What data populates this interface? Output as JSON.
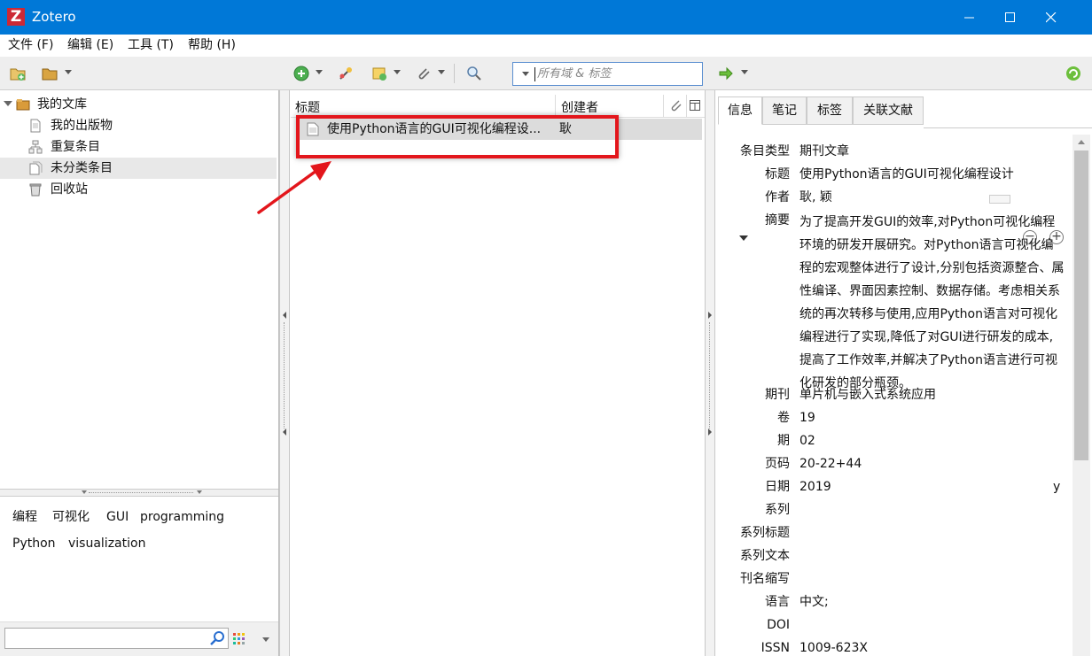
{
  "window": {
    "title": "Zotero",
    "logo_letter": "Z"
  },
  "menu": [
    {
      "label": "文件 (F)"
    },
    {
      "label": "编辑 (E)"
    },
    {
      "label": "工具 (T)"
    },
    {
      "label": "帮助 (H)"
    }
  ],
  "search": {
    "placeholder": "所有域 & 标签"
  },
  "library": {
    "root": "我的文库",
    "items": [
      {
        "label": "我的出版物"
      },
      {
        "label": "重复条目"
      },
      {
        "label": "未分类条目"
      },
      {
        "label": "回收站"
      }
    ]
  },
  "tags": [
    "编程",
    "可视化",
    "GUI",
    "programming",
    "Python",
    "visualization"
  ],
  "items_list": {
    "columns": {
      "title": "标题",
      "creator": "创建者"
    },
    "rows": [
      {
        "title": "使用Python语言的GUI可视化编程设...",
        "creator": "耿"
      }
    ]
  },
  "tabs": [
    "信息",
    "笔记",
    "标签",
    "关联文献"
  ],
  "info": {
    "item_type_label": "条目类型",
    "item_type": "期刊文章",
    "title_label": "标题",
    "title": "使用Python语言的GUI可视化编程设计",
    "author_label": "作者",
    "author": "耿, 颖",
    "abstract_label": "摘要",
    "abstract": "为了提高开发GUI的效率,对Python可视化编程环境的研发开展研究。对Python语言可视化编程的宏观整体进行了设计,分别包括资源整合、属性编译、界面因素控制、数据存储。考虑相关系统的再次转移与使用,应用Python语言对可视化编程进行了实现,降低了对GUI进行研发的成本,提高了工作效率,并解决了Python语言进行可视化研发的部分瓶颈。",
    "publication_label": "期刊",
    "publication": "单片机与嵌入式系统应用",
    "volume_label": "卷",
    "volume": "19",
    "issue_label": "期",
    "issue": "02",
    "pages_label": "页码",
    "pages": "20-22+44",
    "date_label": "日期",
    "date": "2019",
    "date_suffix": "y",
    "series_label": "系列",
    "series_title_label": "系列标题",
    "series_text_label": "系列文本",
    "journal_abbr_label": "刊名缩写",
    "language_label": "语言",
    "language": "中文;",
    "doi_label": "DOI",
    "issn_label": "ISSN",
    "issn": "1009-623X"
  }
}
